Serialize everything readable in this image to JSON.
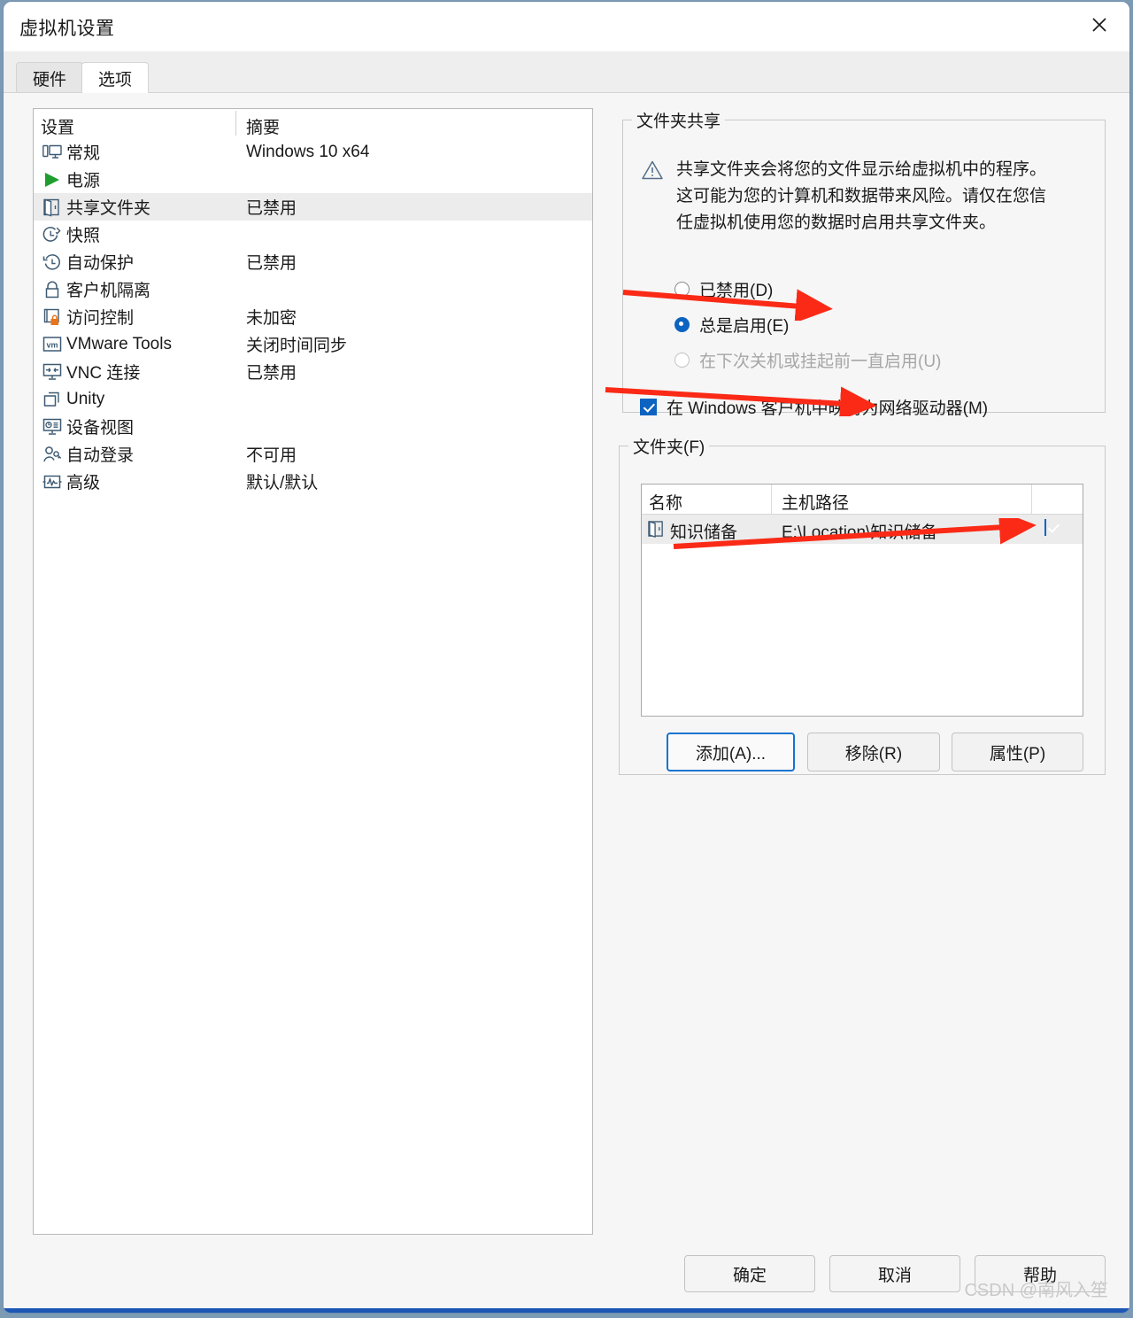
{
  "window": {
    "title": "虚拟机设置",
    "close_icon": "close-icon"
  },
  "tabs": [
    {
      "label": "硬件",
      "active": false
    },
    {
      "label": "选项",
      "active": true
    }
  ],
  "settings_list": {
    "headers": {
      "setting": "设置",
      "summary": "摘要"
    },
    "rows": [
      {
        "icon": "monitor-icon",
        "name": "常规",
        "summary": "Windows 10 x64",
        "selected": false
      },
      {
        "icon": "power-play-icon",
        "name": "电源",
        "summary": "",
        "selected": false
      },
      {
        "icon": "shared-folder-icon",
        "name": "共享文件夹",
        "summary": "已禁用",
        "selected": true
      },
      {
        "icon": "snapshot-icon",
        "name": "快照",
        "summary": "",
        "selected": false
      },
      {
        "icon": "autoprotect-icon",
        "name": "自动保护",
        "summary": "已禁用",
        "selected": false
      },
      {
        "icon": "lock-icon",
        "name": "客户机隔离",
        "summary": "",
        "selected": false
      },
      {
        "icon": "access-control-icon",
        "name": "访问控制",
        "summary": "未加密",
        "selected": false
      },
      {
        "icon": "vmware-tools-icon",
        "name": "VMware Tools",
        "summary": "关闭时间同步",
        "selected": false
      },
      {
        "icon": "vnc-icon",
        "name": "VNC 连接",
        "summary": "已禁用",
        "selected": false
      },
      {
        "icon": "unity-icon",
        "name": "Unity",
        "summary": "",
        "selected": false
      },
      {
        "icon": "device-view-icon",
        "name": "设备视图",
        "summary": "",
        "selected": false
      },
      {
        "icon": "autologin-icon",
        "name": "自动登录",
        "summary": "不可用",
        "selected": false
      },
      {
        "icon": "advanced-icon",
        "name": "高级",
        "summary": "默认/默认",
        "selected": false
      }
    ]
  },
  "folder_sharing": {
    "legend": "文件夹共享",
    "warning_icon": "warning-triangle-icon",
    "warning_text": "共享文件夹会将您的文件显示给虚拟机中的程序。这可能为您的计算机和数据带来风险。请仅在您信任虚拟机使用您的数据时启用共享文件夹。",
    "options": [
      {
        "label": "已禁用(D)",
        "checked": false,
        "disabled": false
      },
      {
        "label": "总是启用(E)",
        "checked": true,
        "disabled": false
      },
      {
        "label": "在下次关机或挂起前一直启用(U)",
        "checked": false,
        "disabled": true
      }
    ],
    "map_drive": {
      "label": "在 Windows 客户机中映射为网络驱动器(M)",
      "checked": true
    }
  },
  "folders": {
    "legend": "文件夹(F)",
    "columns": {
      "name": "名称",
      "path": "主机路径"
    },
    "rows": [
      {
        "icon": "shared-folder-icon",
        "name": "知识储备",
        "path": "E:\\Location\\知识储备",
        "enabled": true
      }
    ],
    "buttons": {
      "add": "添加(A)...",
      "remove": "移除(R)",
      "properties": "属性(P)"
    }
  },
  "dialog_buttons": {
    "ok": "确定",
    "cancel": "取消",
    "help": "帮助"
  },
  "watermark": "CSDN @南风入笙",
  "colors": {
    "accent": "#0d63c0",
    "focus_border": "#1274cf",
    "selection": "#ececec",
    "annotation": "#fa2a16",
    "power_icon": "#1f9d2f",
    "access_lock": "#e8741c"
  }
}
